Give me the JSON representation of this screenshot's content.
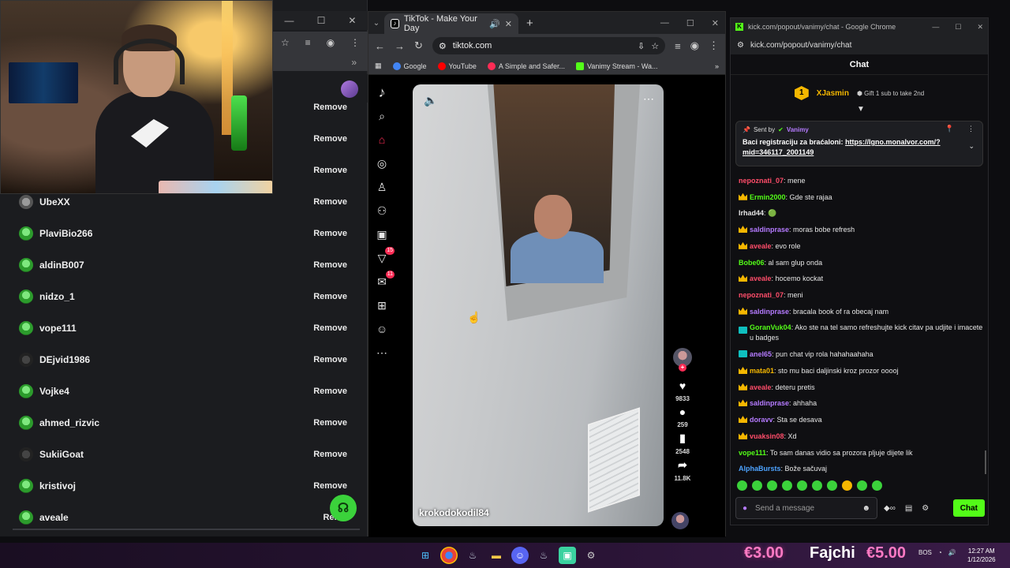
{
  "left_window": {
    "users": [
      {
        "name": "",
        "action": "Remove",
        "avatar": "hidden"
      },
      {
        "name": "",
        "action": "Remove",
        "avatar": "hidden"
      },
      {
        "name": "",
        "action": "Remove",
        "avatar": "hidden"
      },
      {
        "name": "UbeXX",
        "action": "Remove",
        "avatar": "gray"
      },
      {
        "name": "PlaviBio266",
        "action": "Remove",
        "avatar": "green"
      },
      {
        "name": "aldinB007",
        "action": "Remove",
        "avatar": "green"
      },
      {
        "name": "nidzo_1",
        "action": "Remove",
        "avatar": "green"
      },
      {
        "name": "vope111",
        "action": "Remove",
        "avatar": "green"
      },
      {
        "name": "DEjvid1986",
        "action": "Remove",
        "avatar": "dark"
      },
      {
        "name": "Vojke4",
        "action": "Remove",
        "avatar": "green"
      },
      {
        "name": "ahmed_rizvic",
        "action": "Remove",
        "avatar": "green"
      },
      {
        "name": "SukiiGoat",
        "action": "Remove",
        "avatar": "dark"
      },
      {
        "name": "kristivoj",
        "action": "Remove",
        "avatar": "green"
      },
      {
        "name": "aveale",
        "action": "Remo",
        "avatar": "green"
      }
    ]
  },
  "tiktok": {
    "tab_title": "TikTok - Make Your Day",
    "url": "tiktok.com",
    "bookmarks": [
      {
        "label": "Google",
        "color": "#4285f4"
      },
      {
        "label": "YouTube",
        "color": "#ff0000"
      },
      {
        "label": "A Simple and Safer...",
        "color": "#fe2c55"
      },
      {
        "label": "Vanimy Stream - Wa...",
        "color": "#53fc18"
      }
    ],
    "sidebar_badges": {
      "inbox": "15",
      "messages": "11"
    },
    "video": {
      "author": "krokodokodil84"
    },
    "stats": {
      "likes": "9833",
      "comments": "259",
      "saves": "2548",
      "shares": "11.8K"
    }
  },
  "kick": {
    "window_title": "kick.com/popout/vanimy/chat - Google Chrome",
    "url": "kick.com/popout/vanimy/chat",
    "header": "Chat",
    "leaderboard": {
      "rank": "1",
      "name": "XJasmin",
      "gift_text": "Gift 1 sub to take 2nd"
    },
    "pinned": {
      "sent_by_label": "Sent by",
      "author": "Vanimy",
      "text": "Baci registraciju za braćaloni: ",
      "link": "https://lgno.monalvor.com/?mid=346117_2001149"
    },
    "messages": [
      {
        "badge": "",
        "user": "nepoznati_07",
        "color": "#ff4d6a",
        "text": "mene"
      },
      {
        "badge": "crown",
        "user": "Ermin2000",
        "color": "#53fc18",
        "text": "Gde ste rajaa"
      },
      {
        "badge": "",
        "user": "Irhad44",
        "color": "#e6e6e6",
        "text": "🟢"
      },
      {
        "badge": "crown",
        "user": "saldinprase",
        "color": "#b57bff",
        "text": "moras bobe refresh"
      },
      {
        "badge": "crown",
        "user": "aveale",
        "color": "#ff4d6a",
        "text": "evo role"
      },
      {
        "badge": "",
        "user": "Bobe06",
        "color": "#53fc18",
        "text": "al sam glup onda"
      },
      {
        "badge": "crown",
        "user": "aveale",
        "color": "#ff4d6a",
        "text": "hocemo kockat"
      },
      {
        "badge": "",
        "user": "nepoznati_07",
        "color": "#ff4d6a",
        "text": "meni"
      },
      {
        "badge": "crown",
        "user": "saldinprase",
        "color": "#b57bff",
        "text": "bracala book of ra obecaj nam"
      },
      {
        "badge": "vip",
        "user": "GoranVuk04",
        "color": "#53fc18",
        "text": "Ako ste na tel samo refreshujte kick citav pa udjite i imacete u badges",
        "wrap": true
      },
      {
        "badge": "vip",
        "user": "anel65",
        "color": "#b57bff",
        "text": "pun chat vip rola hahahaahaha"
      },
      {
        "badge": "crown",
        "user": "mata01",
        "color": "#f5b700",
        "text": "sto mu baci daljinski kroz prozor ooooj"
      },
      {
        "badge": "crown",
        "user": "aveale",
        "color": "#ff4d6a",
        "text": "deteru pretis"
      },
      {
        "badge": "crown",
        "user": "saldinprase",
        "color": "#b57bff",
        "text": "ahhaha"
      },
      {
        "badge": "crown",
        "user": "doravv",
        "color": "#b57bff",
        "text": "Sta se desava"
      },
      {
        "badge": "crown",
        "user": "vuaksin08",
        "color": "#ff4d6a",
        "text": "Xd"
      },
      {
        "badge": "",
        "user": "vope111",
        "color": "#53fc18",
        "text": "To sam danas vidio sa prozora pljuje dijete lik"
      },
      {
        "badge": "",
        "user": "AlphaBursts",
        "color": "#4da3ff",
        "text": "Bože sačuvaj"
      }
    ],
    "input_placeholder": "Send a message",
    "chat_button": "Chat"
  },
  "taskbar": {
    "overlay_left": "€3.00",
    "overlay_name": "Fajchi",
    "overlay_right": "€5.00",
    "tray_lang": "BOS",
    "time": "12:27 AM",
    "date": "1/12/2026"
  }
}
